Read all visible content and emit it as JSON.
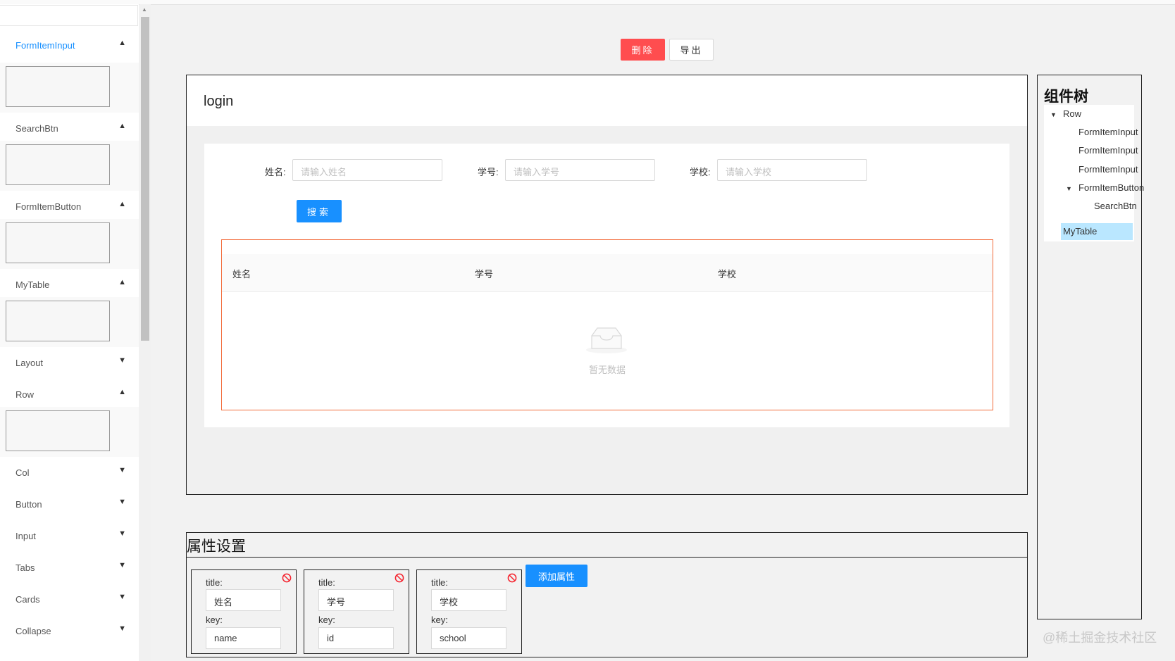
{
  "sidebar": {
    "items": [
      {
        "label": "FormItemInput",
        "expanded": true,
        "active": true
      },
      {
        "label": "SearchBtn",
        "expanded": true
      },
      {
        "label": "FormItemButton",
        "expanded": true
      },
      {
        "label": "MyTable",
        "expanded": true
      },
      {
        "label": "Layout",
        "expanded": false
      },
      {
        "label": "Row",
        "expanded": true
      },
      {
        "label": "Col",
        "expanded": false
      },
      {
        "label": "Button",
        "expanded": false
      },
      {
        "label": "Input",
        "expanded": false
      },
      {
        "label": "Tabs",
        "expanded": false
      },
      {
        "label": "Cards",
        "expanded": false
      },
      {
        "label": "Collapse",
        "expanded": false
      }
    ],
    "chevron_up_icon": "chevron-up-icon",
    "chevron_down_icon": "chevron-down-icon"
  },
  "toolbar": {
    "delete_label": "删除",
    "export_label": "导出"
  },
  "canvas": {
    "title": "login",
    "form": {
      "fields": [
        {
          "label": "姓名:",
          "placeholder": "请输入姓名"
        },
        {
          "label": "学号:",
          "placeholder": "请输入学号"
        },
        {
          "label": "学校:",
          "placeholder": "请输入学校"
        }
      ],
      "search_label": "搜索"
    },
    "table": {
      "columns": [
        "姓名",
        "学号",
        "学校"
      ],
      "empty_text": "暂无数据",
      "empty_icon": "inbox-icon",
      "border_color": "#f26b3a"
    }
  },
  "tree": {
    "title": "组件树",
    "nodes": [
      {
        "label": "Row",
        "level": 0,
        "caret": true
      },
      {
        "label": "FormItemInput",
        "level": 1
      },
      {
        "label": "FormItemInput",
        "level": 1
      },
      {
        "label": "FormItemInput",
        "level": 1
      },
      {
        "label": "FormItemButton",
        "level": 1,
        "caret": true
      },
      {
        "label": "SearchBtn",
        "level": 2
      },
      {
        "label": "MyTable",
        "level": 1,
        "selected": true
      }
    ],
    "selected_color": "#bae7ff"
  },
  "props": {
    "title": "属性设置",
    "title_label": "title:",
    "key_label": "key:",
    "items": [
      {
        "title": "姓名",
        "key": "name"
      },
      {
        "title": "学号",
        "key": "id"
      },
      {
        "title": "学校",
        "key": "school"
      }
    ],
    "add_label": "添加属性",
    "remove_icon": "ban-icon"
  },
  "watermark": "@稀土掘金技术社区",
  "colors": {
    "primary": "#1890ff",
    "danger": "#ff4d4f"
  }
}
